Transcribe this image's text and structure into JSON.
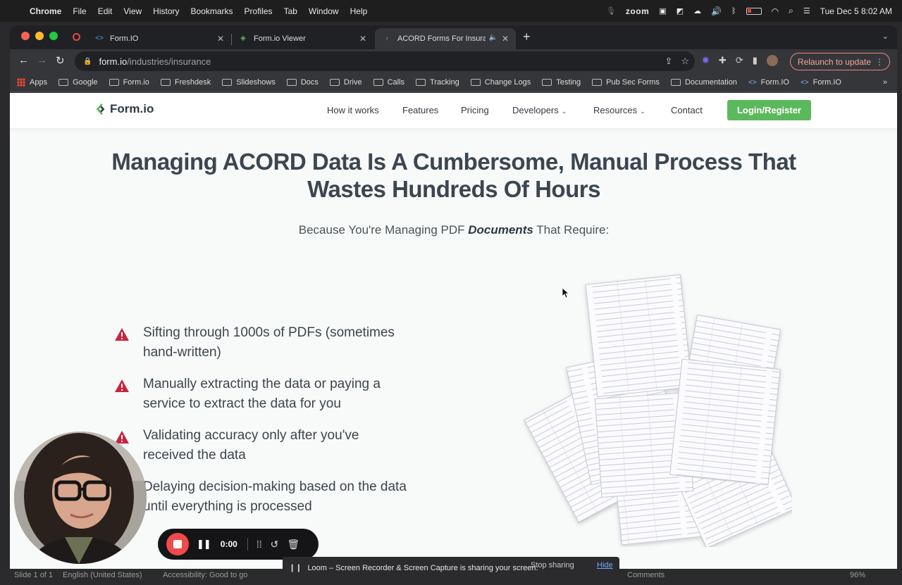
{
  "menubar": {
    "app": "Chrome",
    "items": [
      "File",
      "Edit",
      "View",
      "History",
      "Bookmarks",
      "Profiles",
      "Tab",
      "Window",
      "Help"
    ],
    "zoom_label": "zoom",
    "datetime": "Tue Dec 5  8:02 AM"
  },
  "tabs": [
    {
      "title": "Form.IO"
    },
    {
      "title": "Form.io Viewer"
    },
    {
      "title": "ACORD Forms For Insuran"
    }
  ],
  "toolbar": {
    "url_host": "form.io",
    "url_path": "/industries/insurance",
    "relaunch_label": "Relaunch to update"
  },
  "bookmarks": [
    "Apps",
    "Google",
    "Form.io",
    "Freshdesk",
    "Slideshows",
    "Docs",
    "Drive",
    "Calls",
    "Tracking",
    "Change Logs",
    "Testing",
    "Pub Sec Forms",
    "Documentation",
    "Form.IO",
    "Form.IO"
  ],
  "site": {
    "logo": "Form.io",
    "nav": {
      "how": "How it works",
      "features": "Features",
      "pricing": "Pricing",
      "developers": "Developers",
      "resources": "Resources",
      "contact": "Contact",
      "login": "Login/Register"
    },
    "headline_line1": "Managing ACORD Data Is A Cumbersome, Manual Process That",
    "headline_line2": "Wastes Hundreds Of Hours",
    "subhead_before": "Because You're Managing PDF ",
    "subhead_em": "Documents",
    "subhead_after": " That Require:",
    "bullets": [
      {
        "line1": "Sifting through 1000s of PDFs (sometimes",
        "line2": "hand-written)"
      },
      {
        "line1": "Manually extracting the data or paying a",
        "line2": "service to extract the data for you"
      },
      {
        "line1": "Validating accuracy only after you've",
        "line2": "received the data"
      },
      {
        "line1": "Delaying decision-making based on the data",
        "line2": "until everything is processed"
      }
    ]
  },
  "loom": {
    "timer": "0:00",
    "share_message": "Loom – Screen Recorder & Screen Capture is sharing your screen.",
    "stop_label": "Stop sharing",
    "hide_label": "Hide"
  },
  "statusbar": {
    "slide": "Slide 1 of 1",
    "language": "English (United States)",
    "accessibility": "Accessibility: Good to go",
    "comments": "Comments",
    "zoom": "96%"
  },
  "colors": {
    "accent_green": "#5cb85c",
    "warning_red": "#c8243f",
    "headline": "#3b4650"
  }
}
